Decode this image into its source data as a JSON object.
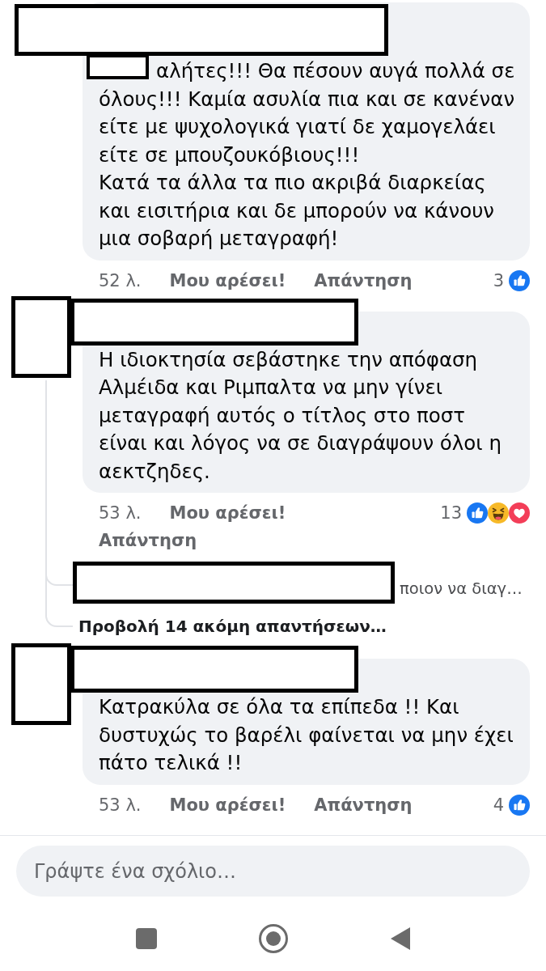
{
  "comments": [
    {
      "redactions": [
        {
          "kind": "header"
        },
        {
          "kind": "mention"
        }
      ],
      "text": "αλήτες!!! Θα πέσουν αυγά πολλά σε όλους!!! Καμία ασυλία πια και σε κανέναν είτε με ψυχολογικά γιατί δε χαμογελάει είτε σε μπουζουκόβιους!!!\nΚατά τα άλλα τα πιο ακριβά διαρκείας και εισιτήρια και δε μπορούν να κάνουν μια σοβαρή μεταγραφή!",
      "time": "52 λ.",
      "like_action": "Μου αρέσει!",
      "reply_action": "Απάντηση",
      "reaction_count": "3",
      "reactions": [
        {
          "kind": "like"
        }
      ]
    },
    {
      "redactions": [
        {
          "kind": "avatar"
        },
        {
          "kind": "name"
        }
      ],
      "text": "Η ιδιοκτησία σεβάστηκε την απόφαση Αλμέιδα και Ριμπαλτα να μην γίνει μεταγραφή αυτός ο τίτλος στο ποστ είναι και λόγος να σε διαγράψουν όλοι η αεκτζηδες.",
      "time": "53 λ.",
      "like_action": "Μου αρέσει!",
      "reply_action": "Απάντηση",
      "reaction_count": "13",
      "reactions": [
        {
          "kind": "like"
        },
        {
          "kind": "haha"
        },
        {
          "kind": "love"
        }
      ],
      "replies": {
        "preview": {
          "redactions": [
            {
              "kind": "row"
            }
          ],
          "text": "ποιον να διαγ…"
        },
        "more_link": "Προβολή 14 ακόμη απαντήσεων…"
      }
    },
    {
      "redactions": [
        {
          "kind": "avatar"
        },
        {
          "kind": "name"
        }
      ],
      "text": "Κατρακύλα σε όλα τα επίπεδα !! Και δυστυχώς το βαρέλι φαίνεται να μην έχει πάτο τελικά !!",
      "time": "53 λ.",
      "like_action": "Μου αρέσει!",
      "reply_action": "Απάντηση",
      "reaction_count": "4",
      "reactions": [
        {
          "kind": "like"
        }
      ]
    }
  ],
  "composer": {
    "placeholder": "Γράψτε ένα σχόλιο…"
  }
}
